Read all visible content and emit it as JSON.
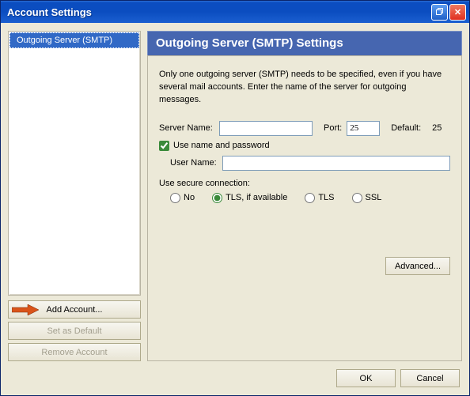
{
  "window": {
    "title": "Account Settings"
  },
  "sidebar": {
    "items": [
      {
        "label": "Outgoing Server (SMTP)"
      }
    ],
    "buttons": {
      "add": "Add Account...",
      "default": "Set as Default",
      "remove": "Remove Account"
    }
  },
  "main": {
    "heading": "Outgoing Server (SMTP) Settings",
    "description": "Only one outgoing server (SMTP) needs to be specified, even if you have several mail accounts. Enter the name of the server for outgoing messages.",
    "server_name_label": "Server Name:",
    "server_name_value": "",
    "port_label": "Port:",
    "port_value": "25",
    "default_label": "Default:",
    "default_value": "25",
    "use_auth_label": "Use name and password",
    "use_auth_checked": true,
    "user_name_label": "User Name:",
    "user_name_value": "",
    "secure_label": "Use secure connection:",
    "secure_options": {
      "no": "No",
      "tls_if": "TLS, if available",
      "tls": "TLS",
      "ssl": "SSL"
    },
    "secure_selected": "tls_if",
    "advanced_label": "Advanced..."
  },
  "footer": {
    "ok": "OK",
    "cancel": "Cancel"
  }
}
